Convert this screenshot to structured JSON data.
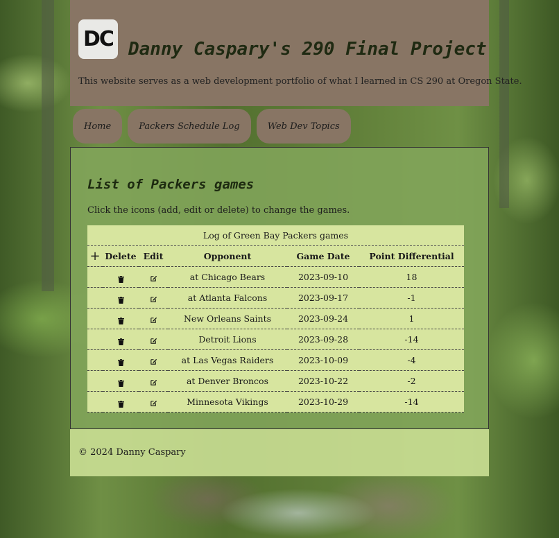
{
  "header": {
    "logo_text": "DC",
    "title": "Danny Caspary's 290 Final Project",
    "tagline": "This website serves as a web development portfolio of what I learned in CS 290 at Oregon State."
  },
  "nav": {
    "items": [
      {
        "label": "Home"
      },
      {
        "label": "Packers Schedule Log"
      },
      {
        "label": "Web Dev Topics"
      }
    ]
  },
  "main": {
    "title": "List of Packers games",
    "instructions": "Click the icons (add, edit or delete) to change the games.",
    "table": {
      "caption": "Log of Green Bay Packers games",
      "add_symbol": "+",
      "headers": {
        "delete": "Delete",
        "edit": "Edit",
        "opponent": "Opponent",
        "date": "Game Date",
        "diff": "Point Differential"
      },
      "rows": [
        {
          "opponent": "at Chicago Bears",
          "date": "2023-09-10",
          "diff": "18"
        },
        {
          "opponent": "at Atlanta Falcons",
          "date": "2023-09-17",
          "diff": "-1"
        },
        {
          "opponent": "New Orleans Saints",
          "date": "2023-09-24",
          "diff": "1"
        },
        {
          "opponent": "Detroit Lions",
          "date": "2023-09-28",
          "diff": "-14"
        },
        {
          "opponent": "at Las Vegas Raiders",
          "date": "2023-10-09",
          "diff": "-4"
        },
        {
          "opponent": "at Denver Broncos",
          "date": "2023-10-22",
          "diff": "-2"
        },
        {
          "opponent": "Minnesota Vikings",
          "date": "2023-10-29",
          "diff": "-14"
        }
      ]
    }
  },
  "footer": {
    "copyright": "© 2024 Danny Caspary"
  },
  "colors": {
    "header_bg": "#887564",
    "content_bg": "#82a55a",
    "table_bg": "#d7e59f",
    "footer_bg": "#cde196"
  }
}
